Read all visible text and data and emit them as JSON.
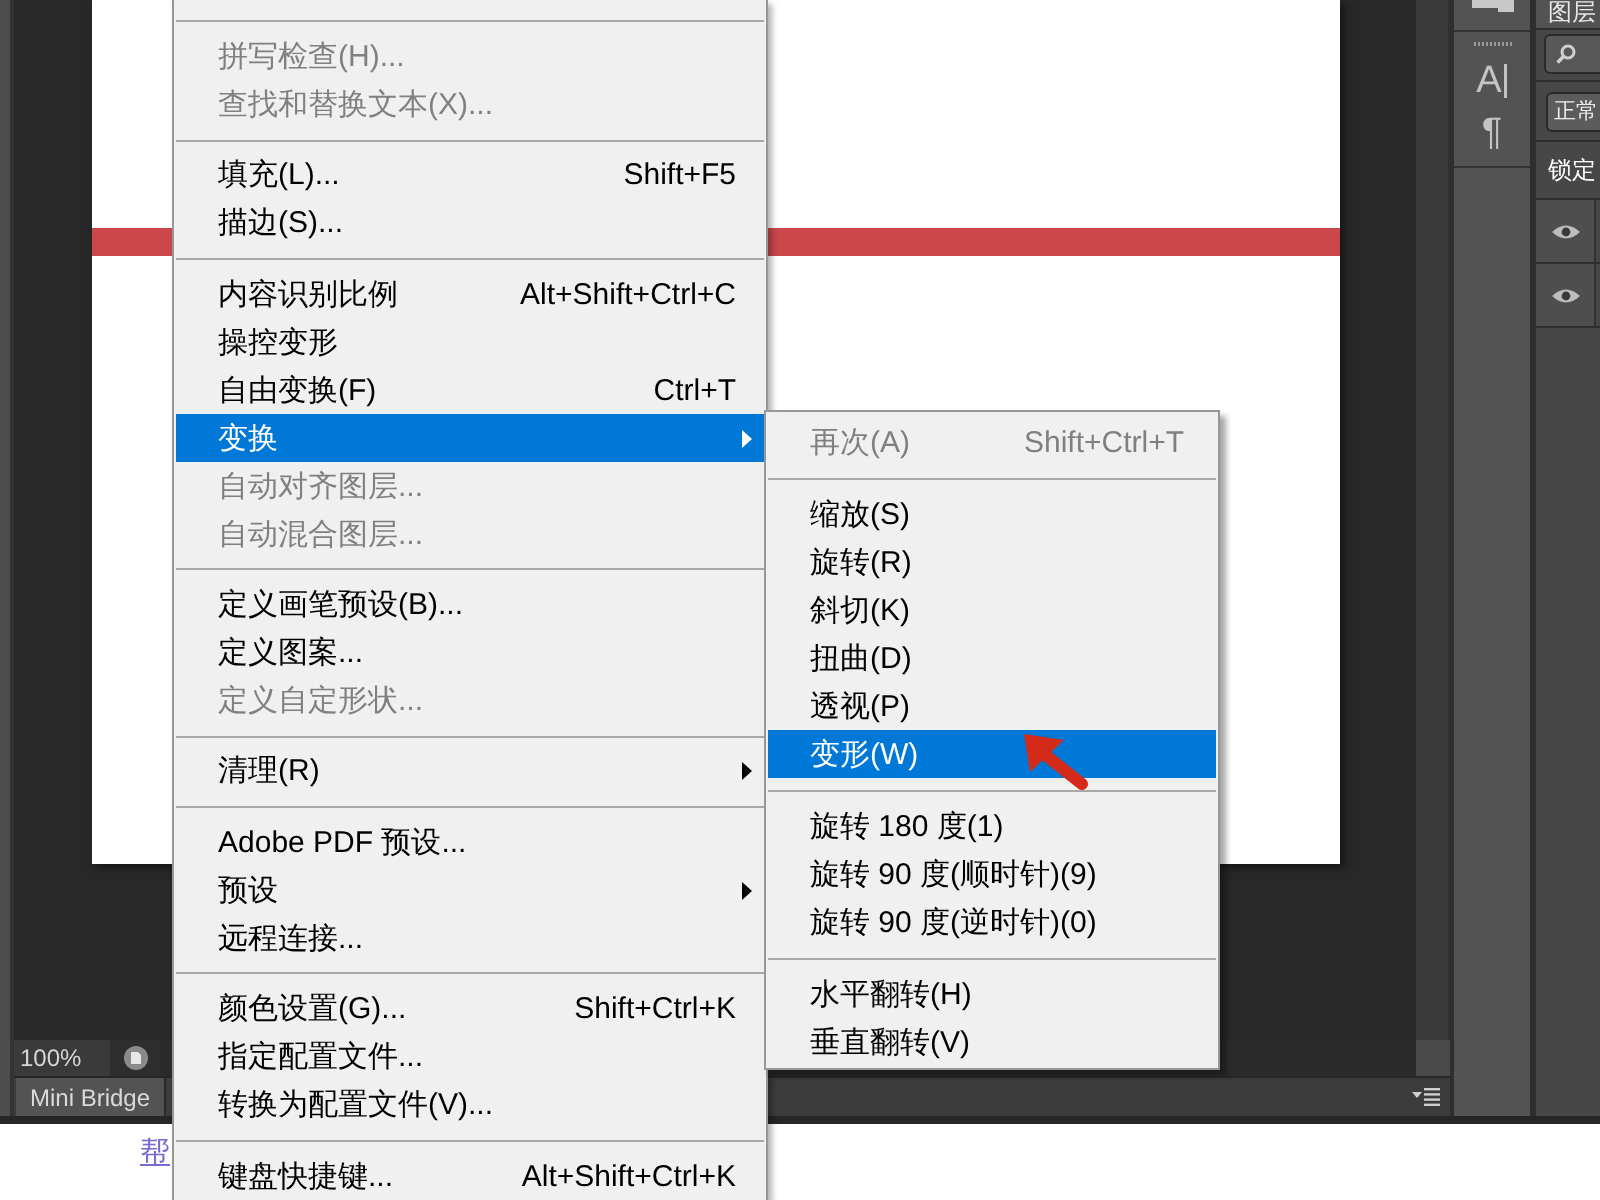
{
  "main_menu": {
    "continues_above": true,
    "groups": [
      [
        {
          "label": "拼写检查(H)...",
          "disabled": true,
          "submenu": false,
          "selected": false
        },
        {
          "label": "查找和替换文本(X)...",
          "disabled": true,
          "submenu": false,
          "selected": false
        }
      ],
      [
        {
          "label": "填充(L)...",
          "shortcut": "Shift+F5",
          "disabled": false,
          "submenu": false,
          "selected": false
        },
        {
          "label": "描边(S)...",
          "disabled": false,
          "submenu": false,
          "selected": false
        }
      ],
      [
        {
          "label": "内容识别比例",
          "shortcut": "Alt+Shift+Ctrl+C",
          "disabled": false,
          "submenu": false,
          "selected": false
        },
        {
          "label": "操控变形",
          "disabled": false,
          "submenu": false,
          "selected": false
        },
        {
          "label": "自由变换(F)",
          "shortcut": "Ctrl+T",
          "disabled": false,
          "submenu": false,
          "selected": false
        },
        {
          "label": "变换",
          "disabled": false,
          "submenu": true,
          "selected": true
        },
        {
          "label": "自动对齐图层...",
          "disabled": true,
          "submenu": false,
          "selected": false
        },
        {
          "label": "自动混合图层...",
          "disabled": true,
          "submenu": false,
          "selected": false
        }
      ],
      [
        {
          "label": "定义画笔预设(B)...",
          "disabled": false,
          "submenu": false,
          "selected": false
        },
        {
          "label": "定义图案...",
          "disabled": false,
          "submenu": false,
          "selected": false
        },
        {
          "label": "定义自定形状...",
          "disabled": true,
          "submenu": false,
          "selected": false
        }
      ],
      [
        {
          "label": "清理(R)",
          "disabled": false,
          "submenu": true,
          "selected": false
        }
      ],
      [
        {
          "label": "Adobe PDF 预设...",
          "disabled": false,
          "submenu": false,
          "selected": false
        },
        {
          "label": "预设",
          "disabled": false,
          "submenu": true,
          "selected": false
        },
        {
          "label": "远程连接...",
          "disabled": false,
          "submenu": false,
          "selected": false
        }
      ],
      [
        {
          "label": "颜色设置(G)...",
          "shortcut": "Shift+Ctrl+K",
          "disabled": false,
          "submenu": false,
          "selected": false
        },
        {
          "label": "指定配置文件...",
          "disabled": false,
          "submenu": false,
          "selected": false
        },
        {
          "label": "转换为配置文件(V)...",
          "disabled": false,
          "submenu": false,
          "selected": false
        }
      ],
      [
        {
          "label": "键盘快捷键...",
          "shortcut": "Alt+Shift+Ctrl+K",
          "disabled": false,
          "submenu": false,
          "selected": false
        }
      ]
    ]
  },
  "submenu": {
    "groups": [
      [
        {
          "label": "再次(A)",
          "shortcut": "Shift+Ctrl+T",
          "disabled": true,
          "selected": false
        }
      ],
      [
        {
          "label": "缩放(S)",
          "disabled": false,
          "selected": false
        },
        {
          "label": "旋转(R)",
          "disabled": false,
          "selected": false
        },
        {
          "label": "斜切(K)",
          "disabled": false,
          "selected": false
        },
        {
          "label": "扭曲(D)",
          "disabled": false,
          "selected": false
        },
        {
          "label": "透视(P)",
          "disabled": false,
          "selected": false
        },
        {
          "label": "变形(W)",
          "disabled": false,
          "selected": true
        }
      ],
      [
        {
          "label": "旋转 180 度(1)",
          "disabled": false,
          "selected": false
        },
        {
          "label": "旋转 90 度(顺时针)(9)",
          "disabled": false,
          "selected": false
        },
        {
          "label": "旋转 90 度(逆时针)(0)",
          "disabled": false,
          "selected": false
        }
      ],
      [
        {
          "label": "水平翻转(H)",
          "disabled": false,
          "selected": false
        },
        {
          "label": "垂直翻转(V)",
          "disabled": false,
          "selected": false
        }
      ]
    ]
  },
  "status_bar": {
    "zoom": "100%"
  },
  "mini_bridge": {
    "tab": "Mini Bridge"
  },
  "panel_dock": {
    "buttons": [
      {
        "kind": "character",
        "glyph": "A"
      },
      {
        "kind": "paragraph",
        "glyph": "¶"
      }
    ]
  },
  "layers_panel": {
    "tab": "图层",
    "blend_mode": "正常",
    "lock_label": "锁定",
    "layers": [
      {
        "visible": true
      },
      {
        "visible": true
      }
    ]
  },
  "web_page": {
    "link": "帮"
  }
}
